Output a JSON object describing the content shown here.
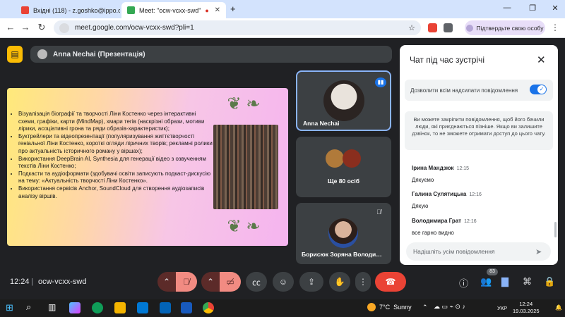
{
  "browser": {
    "tabs": [
      {
        "label": "Вхідні (118) - z.goshko@ippo.o"
      },
      {
        "label": "Meet: \"ocw-vcxx-swd\""
      }
    ],
    "url": "meet.google.com/ocw-vcxx-swd?pli=1",
    "confirm_label": "Підтвердьте свою особу"
  },
  "presentation": {
    "presenter": "Anna Nechai (Презентація)",
    "bullets": [
      "Візуалізація біографії та творчості Ліни Костенко через інтерактивні схеми, графіки, карти (MindMap), хмари тегів (наскрізні образи, мотиви лірики, асоціативні грона та ряди образів-характеристик);",
      "Буктрейлери та відеопрезентації (популяризування життєтворчості геніальної Ліни Костенко, короткі огляди ліричних творів; рекламні ролики про актуальність історичного роману у віршах);",
      "Використання DeepBrain AI, Synthesia для генерації відео з озвученням текстів Ліни Костенко;",
      "Подкасти та аудіоформати (здобувачі освіти записують подкаст-дискусію на тему: «Актуальність творчості Ліни Костенко».",
      "Використання сервісів Anchor, SoundCloud для створення аудіозаписів аналізу віршів."
    ]
  },
  "tiles": {
    "anna": "Anna Nechai",
    "others": "Ще 80 осіб",
    "borysiuk": "Борисюк Зоряна Володи…"
  },
  "chat": {
    "title": "Чат під час зустрічі",
    "allow_label": "Дозволити всім надсилати повідомлення",
    "notice": "Ви можете закріпити повідомлення, щоб його бачили люди, які приєднаються пізніше. Якщо ви залишите дзвінок, то не зможете отримати доступ до цього чату.",
    "messages": [
      {
        "author": "Ірина Мандзюк",
        "time": "12:15",
        "text": "Дякуємо"
      },
      {
        "author": "Галина Сулятицька",
        "time": "12:16",
        "text": "Дякую"
      },
      {
        "author": "Володимира Грат",
        "time": "12:16",
        "text": "все гарно видно"
      }
    ],
    "input_placeholder": "Надішліть усім повідомлення"
  },
  "controls": {
    "time": "12:24",
    "meeting_code": "ocw-vcxx-swd",
    "participants_count": "83"
  },
  "taskbar": {
    "temperature": "7°C",
    "weather": "Sunny",
    "lang": "УКР",
    "time": "12:24",
    "date": "19.03.2025"
  }
}
